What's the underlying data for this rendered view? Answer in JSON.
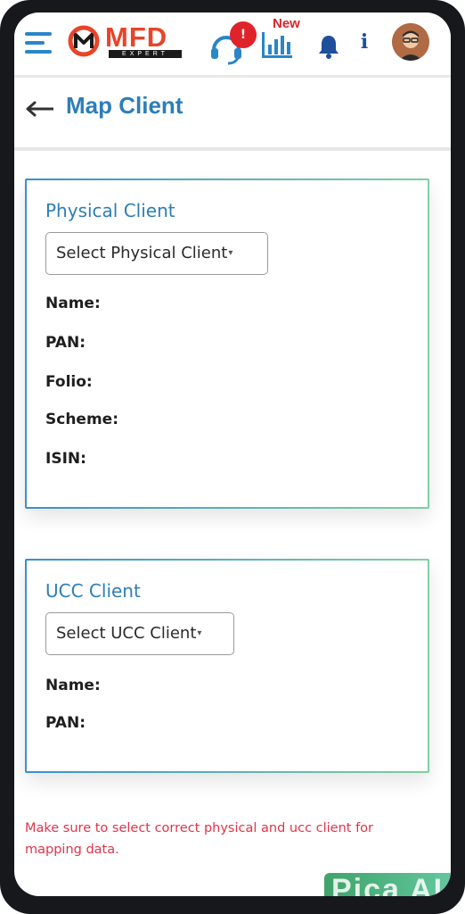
{
  "header": {
    "logo_text": "MFD",
    "logo_subtext": "EXPERT",
    "support_badge": "!",
    "new_label": "New",
    "info_label": "i"
  },
  "title": {
    "text": "Map Client"
  },
  "physical_card": {
    "title": "Physical Client",
    "select_placeholder": "Select Physical Client",
    "fields": [
      "Name:",
      "PAN:",
      "Folio:",
      "Scheme:",
      "ISIN:"
    ]
  },
  "ucc_card": {
    "title": "UCC Client",
    "select_placeholder": "Select UCC Client",
    "fields": [
      "Name:",
      "PAN:"
    ]
  },
  "note": "Make sure to select correct physical and ucc client for mapping data.",
  "watermark": "Pica AI",
  "colors": {
    "accent_blue": "#2d7eb7",
    "brand_orange": "#e8442a",
    "alert_red": "#e0222a",
    "note_red": "#e0344a"
  },
  "icons": [
    "menu-icon",
    "support-headset-icon",
    "bar-chart-icon",
    "bell-icon",
    "info-icon",
    "avatar",
    "back-arrow-icon",
    "caret-down-icon"
  ]
}
